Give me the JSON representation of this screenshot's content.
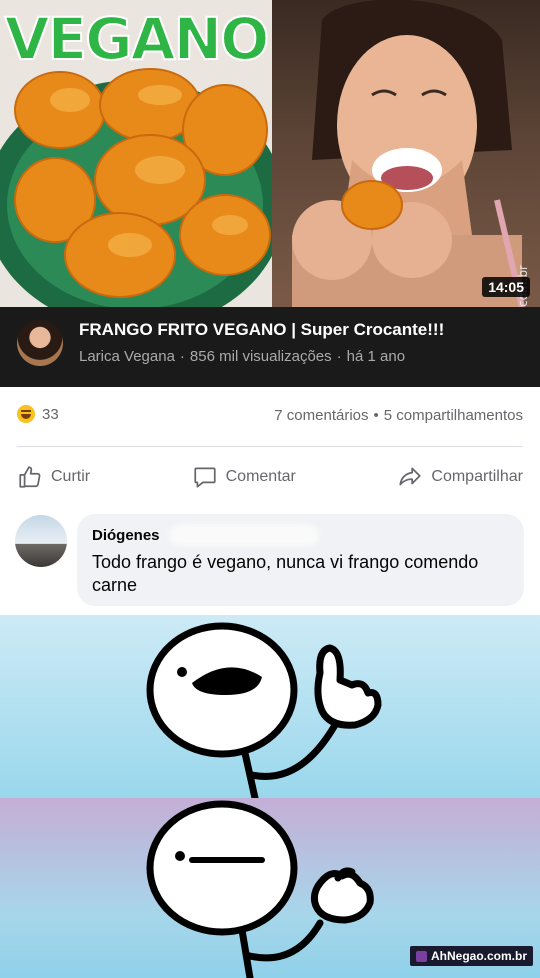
{
  "video": {
    "thumbnail_text": "VEGANO",
    "duration": "14:05",
    "watermark": "AhNegao.com.br",
    "title": "FRANGO FRITO VEGANO | Super Crocante!!!",
    "channel": "Larica Vegana",
    "views": "856 mil visualizações",
    "age": "há 1 ano",
    "meta_separator": "·"
  },
  "post": {
    "reaction_count": "33",
    "comments": "7 comentários",
    "shares": "5 compartilhamentos",
    "stats_separator": "•",
    "actions": {
      "like": "Curtir",
      "comment": "Comentar",
      "share": "Compartilhar"
    },
    "comment": {
      "author": "Diógenes",
      "text": "Todo frango é vegano, nunca vi frango comendo carne"
    }
  },
  "meme": {
    "logo_text": "AhNegao.com.br"
  },
  "colors": {
    "veg_green": "#2fb545",
    "fb_gray": "#65676b",
    "bubble_bg": "#f0f2f5",
    "info_bg": "#1a1a1a"
  },
  "icons": [
    "haha-reaction-icon",
    "like-icon",
    "comment-icon",
    "share-icon"
  ]
}
